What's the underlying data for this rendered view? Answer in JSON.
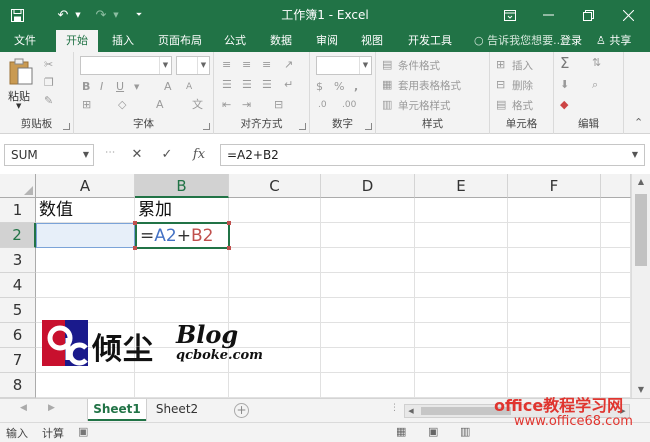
{
  "window": {
    "title": "工作簿1 - Excel",
    "save_icon": "save-icon",
    "undo_icon": "undo-icon",
    "redo_icon": "redo-icon",
    "customize_icon": "customize-qat-icon"
  },
  "tabs": [
    "文件",
    "开始",
    "插入",
    "页面布局",
    "公式",
    "数据",
    "审阅",
    "视图",
    "开发工具"
  ],
  "tell_me": "告诉我您想要...",
  "login": "登录",
  "share": "共享",
  "ribbon": {
    "clipboard": {
      "label": "剪贴板",
      "paste": "粘贴"
    },
    "font": {
      "label": "字体",
      "bold": "B",
      "italic": "I",
      "underline": "U"
    },
    "alignment": {
      "label": "对齐方式"
    },
    "number": {
      "label": "数字",
      "percent": "%",
      "comma": ","
    },
    "styles": {
      "label": "样式",
      "conditional": "条件格式",
      "table": "套用表格格式",
      "cell": "单元格样式"
    },
    "cells": {
      "label": "单元格",
      "insert": "插入",
      "delete": "删除",
      "format": "格式"
    },
    "editing": {
      "label": "编辑"
    }
  },
  "formula_bar": {
    "name_box": "SUM",
    "cancel": "✕",
    "enter": "✓",
    "fx": "fx",
    "formula": "=A2+B2"
  },
  "columns": [
    "A",
    "B",
    "C",
    "D",
    "E",
    "F"
  ],
  "rows": [
    "1",
    "2",
    "3",
    "4",
    "5",
    "6",
    "7",
    "8"
  ],
  "cells": {
    "A1": "数值",
    "B1": "累加",
    "B2": {
      "eq": "=",
      "a2": "A2",
      "plus": "+",
      "b2": "B2"
    }
  },
  "watermark": {
    "name": "倾尘",
    "blog": "Blog",
    "domain": "qcboke.com"
  },
  "sheets": [
    "Sheet1",
    "Sheet2"
  ],
  "add_sheet": "⊕",
  "status": {
    "mode": "输入",
    "calc": "计算"
  },
  "site_watermark": "office教程学习网",
  "site_watermark2": "www.office68.com",
  "colors": {
    "accent": "#217346",
    "ref_a2": "#4472c4",
    "ref_b2": "#c0504d",
    "site_red": "#e0352f"
  }
}
